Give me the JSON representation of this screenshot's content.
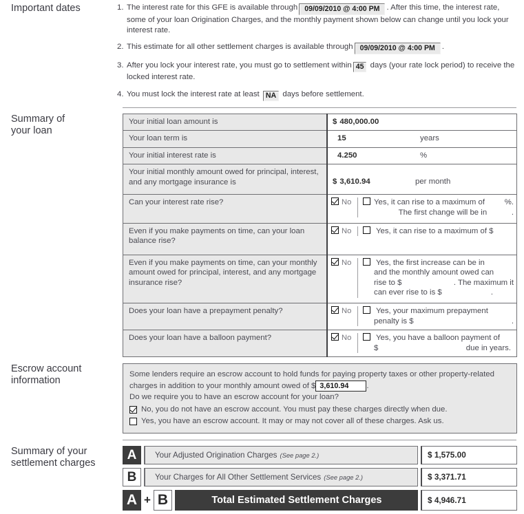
{
  "sections": {
    "important_dates": {
      "label": "Important dates",
      "items": [
        {
          "num": "1.",
          "pre": "The interest rate for this GFE is available through",
          "field": "09/09/2010 @ 4:00 PM",
          "post": ". After this time, the interest rate, some of your loan Origination Charges, and the monthly payment shown below can change until you lock your interest rate."
        },
        {
          "num": "2.",
          "pre": "This estimate for all other settlement charges is available through",
          "field": "09/09/2010 @ 4:00 PM",
          "post": "."
        },
        {
          "num": "3.",
          "pre": "After you lock your interest rate, you must go to settlement within",
          "field": "45",
          "post": "days (your rate lock period) to receive the locked interest rate."
        },
        {
          "num": "4.",
          "pre": "You must lock the interest rate at least",
          "field": "NA",
          "post": "days before settlement."
        }
      ]
    },
    "summary_of_loan": {
      "label_line1": "Summary of",
      "label_line2": "your loan",
      "rows": [
        {
          "question": "Your initial loan amount is",
          "type": "value",
          "dollar": "$",
          "value": "480,000.00",
          "unit": ""
        },
        {
          "question": "Your loan term is",
          "type": "value",
          "dollar": "",
          "value": "15",
          "unit": "years"
        },
        {
          "question": "Your initial interest rate is",
          "type": "value",
          "dollar": "",
          "value": "4.250",
          "unit": "%"
        },
        {
          "question": "Your initial monthly amount owed for principal, interest, and any mortgage insurance is",
          "type": "value",
          "dollar": "$",
          "value": "3,610.94",
          "unit": "per month"
        },
        {
          "question": "Can your interest rate rise?",
          "type": "yesno",
          "no_label": "No",
          "no_checked": true,
          "yes_checked": false,
          "yes_line1": "Yes, it can rise to a maximum of",
          "yes_line1_tail": "%.",
          "yes_line2": "The first change will be in",
          "yes_line2_tail": ".",
          "yes_line3": "",
          "yes_line4": ""
        },
        {
          "question": "Even if you make payments on time, can your loan balance rise?",
          "type": "yesno",
          "no_label": "No",
          "no_checked": true,
          "yes_checked": false,
          "yes_line1": "Yes, it can rise to a maximum of $",
          "yes_line1_tail": "",
          "yes_line2": "",
          "yes_line2_tail": "",
          "yes_line3": "",
          "yes_line4": ""
        },
        {
          "question": "Even if you make payments on time, can your monthly amount owed for principal, interest, and any mortgage insurance rise?",
          "type": "yesno",
          "no_label": "No",
          "no_checked": true,
          "yes_checked": false,
          "yes_line1": "Yes, the first increase can be in",
          "yes_line1_tail": "",
          "yes_line2": "and the monthly amount owed can",
          "yes_line2_tail": "",
          "yes_line3": "rise to  $",
          "yes_line3_tail": ". The maximum it",
          "yes_line4": "can ever rise to is $",
          "yes_line4_tail": "."
        },
        {
          "question": "Does your loan have a prepayment penalty?",
          "type": "yesno",
          "no_label": "No",
          "no_checked": true,
          "yes_checked": false,
          "yes_line1": "Yes, your maximum prepayment",
          "yes_line1_tail": "",
          "yes_line2": "penalty is $",
          "yes_line2_tail": ".",
          "yes_line3": "",
          "yes_line4": ""
        },
        {
          "question": "Does your loan have a balloon payment?",
          "type": "yesno",
          "no_label": "No",
          "no_checked": true,
          "yes_checked": false,
          "yes_line1": "Yes, you have a balloon payment of",
          "yes_line1_tail": "",
          "yes_line2": "$",
          "yes_line2_tail": "due in        years.",
          "yes_line3": "",
          "yes_line4": ""
        }
      ]
    },
    "escrow": {
      "label_line1": "Escrow account",
      "label_line2": "information",
      "para_pre": "Some lenders require an escrow account to hold funds for paying property taxes or other property-related charges in addition to your monthly amount owed of $",
      "amount": "3,610.94",
      "para_post": ".",
      "question": "Do we require you to have an escrow account for your loan?",
      "options": [
        {
          "checked": true,
          "text": "No, you do not have an escrow account. You must pay these charges directly when due."
        },
        {
          "checked": false,
          "text": "Yes, you have an escrow account. It may or may not cover all of these charges. Ask us."
        }
      ]
    },
    "settlement_charges": {
      "label_line1": "Summary of your",
      "label_line2": "settlement charges",
      "rows": [
        {
          "letter": "A",
          "letter_style": "dark",
          "name": "Your Adjusted Origination Charges",
          "see_page": "(See page 2.)",
          "amount": "$ 1,575.00"
        },
        {
          "letter": "B",
          "letter_style": "light",
          "name": "Your Charges for All Other Settlement Services",
          "see_page": "(See page 2.)",
          "amount": "$ 3,371.71"
        }
      ],
      "total": {
        "letter_a": "A",
        "plus": "+",
        "letter_b": "B",
        "name": "Total Estimated Settlement Charges",
        "amount": "$ 4,946.71"
      }
    }
  },
  "colors": {
    "dark_box": "#3c3c3c",
    "shaded_cell": "#e8e8e8",
    "border": "#6f6f73",
    "text": "#4a4a52"
  }
}
